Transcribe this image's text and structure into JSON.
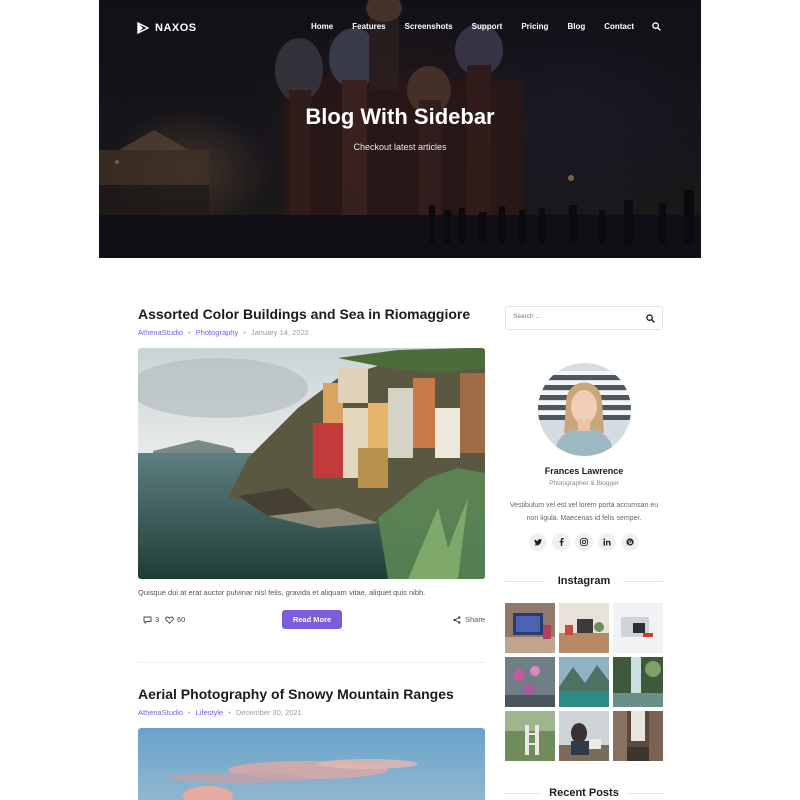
{
  "brand": {
    "name": "NAXOS"
  },
  "nav": {
    "items": [
      "Home",
      "Features",
      "Screenshots",
      "Support",
      "Pricing",
      "Blog",
      "Contact"
    ]
  },
  "hero": {
    "title": "Blog With Sidebar",
    "subtitle": "Checkout latest articles"
  },
  "posts": [
    {
      "title": "Assorted Color Buildings and Sea in Riomaggiore",
      "author": "AthenaStudio",
      "category": "Photography",
      "date": "January 14, 2022",
      "excerpt": "Quisque dui at erat auctor pulvinar nisl felis, gravida et aliquam vitae, aliquet quis nibh.",
      "comments": "3",
      "likes": "60",
      "read_more": "Read More",
      "share": "Share"
    },
    {
      "title": "Aerial Photography of Snowy Mountain Ranges",
      "author": "AthenaStudio",
      "category": "Lifestyle",
      "date": "December 30, 2021"
    }
  ],
  "sidebar": {
    "search_placeholder": "Search ...",
    "author": {
      "name": "Frances Lawrence",
      "role": "Photographer & Blogger",
      "bio": "Vestibulum vel est vel lorem porta accumsan eu non ligula. Maecenas id felis semper."
    },
    "socials": [
      {
        "icon": "twitter-icon",
        "glyph": "🐦"
      },
      {
        "icon": "facebook-icon",
        "glyph": "f"
      },
      {
        "icon": "instagram-icon",
        "glyph": "◎"
      },
      {
        "icon": "linkedin-icon",
        "glyph": "in"
      },
      {
        "icon": "pinterest-icon",
        "glyph": "℗"
      }
    ],
    "instagram_title": "Instagram",
    "recent_posts_title": "Recent Posts"
  },
  "colors": {
    "accent": "#7b5cdb",
    "hero_overlay": "#14161c"
  }
}
